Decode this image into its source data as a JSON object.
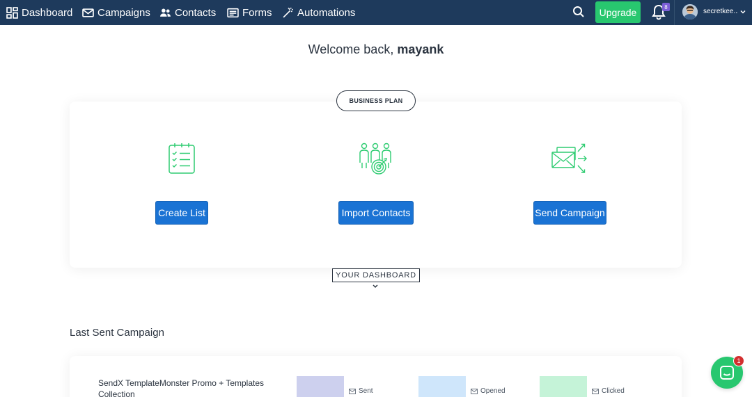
{
  "nav": {
    "items": [
      {
        "label": "Dashboard",
        "icon": "grid-icon"
      },
      {
        "label": "Campaigns",
        "icon": "envelope-icon"
      },
      {
        "label": "Contacts",
        "icon": "users-icon"
      },
      {
        "label": "Forms",
        "icon": "form-icon"
      },
      {
        "label": "Automations",
        "icon": "magic-wand-icon"
      }
    ],
    "upgrade_label": "Upgrade",
    "notification_count": "8",
    "user_name": "secretkee..."
  },
  "welcome": {
    "prefix": "Welcome back, ",
    "name": "mayank"
  },
  "plan": {
    "label": "BUSINESS PLAN"
  },
  "actions": [
    {
      "label": "Create List",
      "icon": "checklist-icon"
    },
    {
      "label": "Import Contacts",
      "icon": "people-target-icon"
    },
    {
      "label": "Send Campaign",
      "icon": "envelope-arrows-icon"
    }
  ],
  "dashboard": {
    "label": "YOUR DASHBOARD"
  },
  "last_sent": {
    "title": "Last Sent Campaign",
    "campaign_name": "SendX TemplateMonster Promo + Templates Collection",
    "stats": [
      {
        "label": "Sent",
        "color": "#cdd0ee"
      },
      {
        "label": "Opened",
        "color": "#cfe6fb"
      },
      {
        "label": "Clicked",
        "color": "#c5f3d8"
      }
    ]
  },
  "chat": {
    "badge_count": "1"
  },
  "colors": {
    "navbar": "#1e3a5c",
    "primary_button": "#1a73d4",
    "upgrade": "#28c76f",
    "icon_green": "#2ecc71"
  }
}
